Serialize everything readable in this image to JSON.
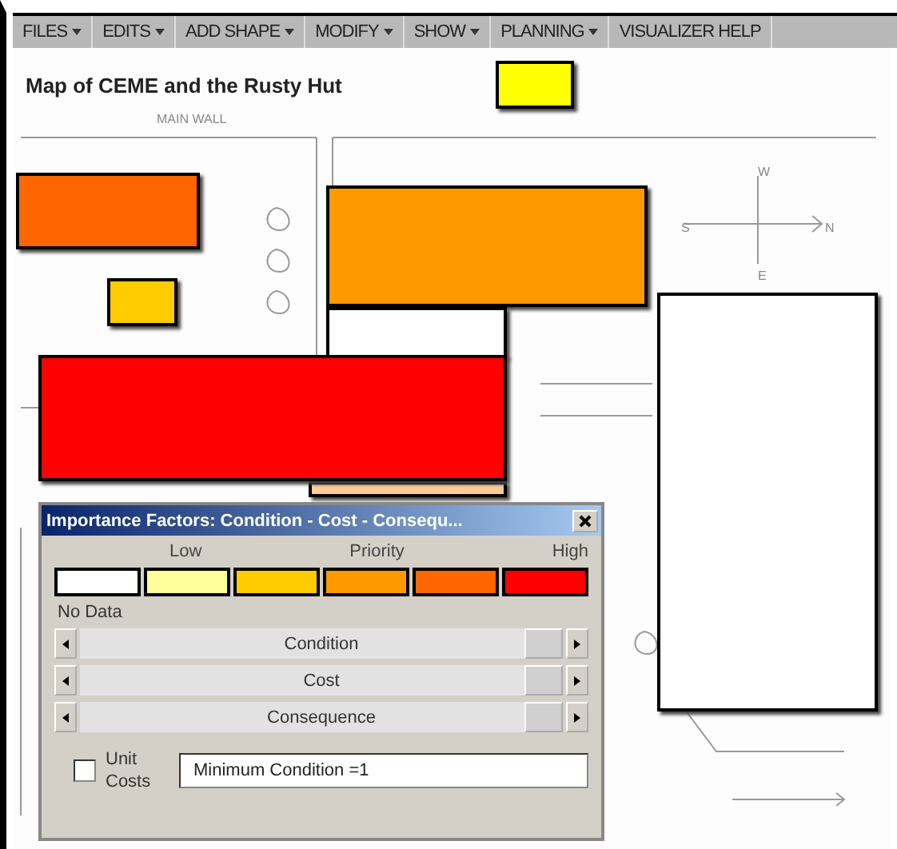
{
  "menu": [
    {
      "label": "FILES",
      "dropdown": true
    },
    {
      "label": "EDITS",
      "dropdown": true
    },
    {
      "label": "ADD SHAPE",
      "dropdown": true
    },
    {
      "label": "MODIFY",
      "dropdown": true
    },
    {
      "label": "SHOW",
      "dropdown": true
    },
    {
      "label": "PLANNING",
      "dropdown": true
    },
    {
      "label": "VISUALIZER HELP",
      "dropdown": false
    }
  ],
  "map": {
    "title": "Map of CEME and the Rusty Hut",
    "labels": [
      "MAIN WALL",
      "W",
      "S",
      "N",
      "E"
    ],
    "shapes": [
      {
        "color": "#ffff00"
      },
      {
        "color": "#ff6600"
      },
      {
        "color": "#ffcc00"
      },
      {
        "color": "#ff9900"
      },
      {
        "color": "#ffffff"
      },
      {
        "color": "#ff0000"
      },
      {
        "color": "#ffcc99"
      },
      {
        "color": "#ffffff"
      }
    ]
  },
  "dialog": {
    "title": "Importance Factors: Condition - Cost - Consequ...",
    "legend_labels": [
      "Low",
      "Priority",
      "High"
    ],
    "swatches": [
      {
        "color": "#ffffff"
      },
      {
        "color": "#ffff99"
      },
      {
        "color": "#ffcc00"
      },
      {
        "color": "#ff9900"
      },
      {
        "color": "#ff6600"
      },
      {
        "color": "#ff0000"
      }
    ],
    "no_data_label": "No Data",
    "sliders": [
      {
        "label": "Condition",
        "level": 1
      },
      {
        "label": "Cost",
        "level": 1
      },
      {
        "label": "Consequence",
        "level": 1
      }
    ],
    "unit_costs": {
      "label": "Unit Costs",
      "checked": false
    },
    "filter": {
      "value": "Minimum Condition =1"
    }
  }
}
